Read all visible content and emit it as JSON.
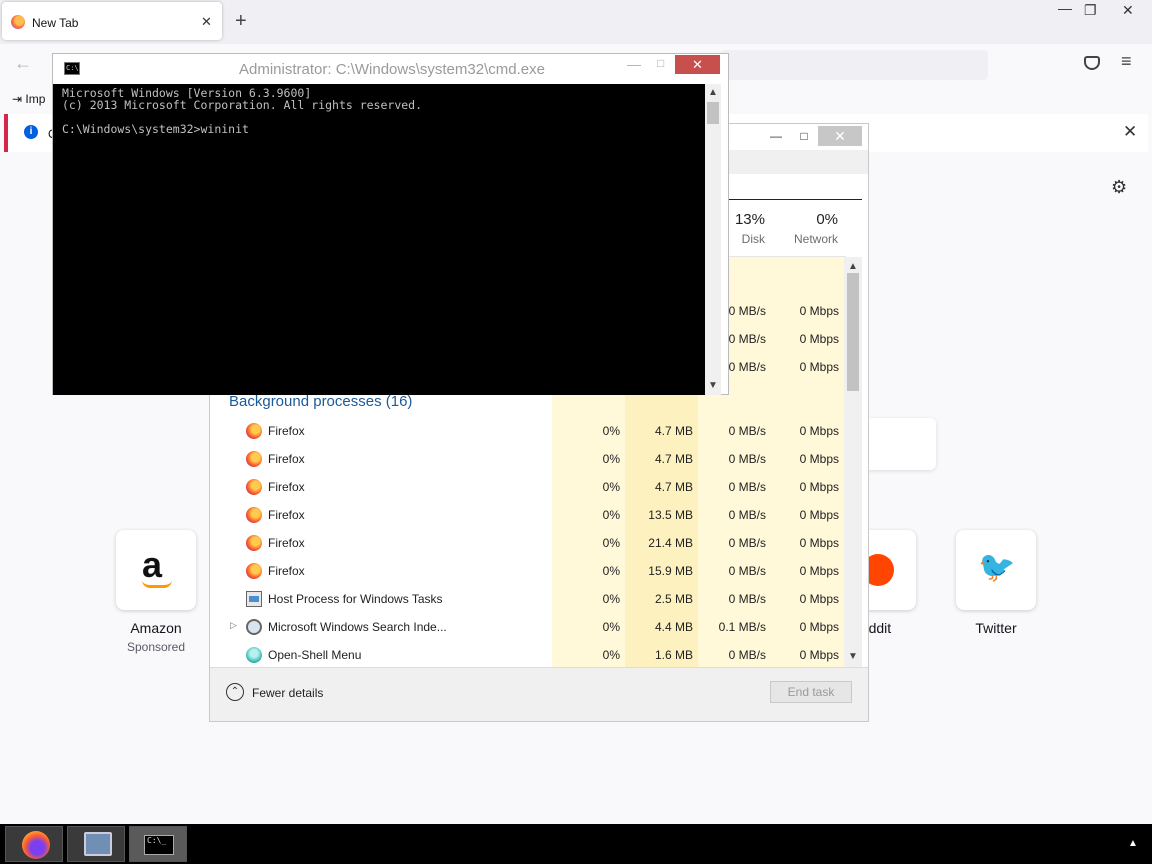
{
  "browser": {
    "tab_title": "New Tab",
    "tab_close": "✕",
    "new_tab": "+",
    "window_min": "—",
    "window_restore": "❐",
    "window_close": "✕",
    "back": "←",
    "menu": "≡",
    "bookmark_import": "Imp",
    "notice_text": "O",
    "notice_close": "✕",
    "settings": "⚙",
    "tiles": [
      {
        "label": "Amazon",
        "sub": "Sponsored",
        "glyph": "a"
      },
      {
        "label": "eddit",
        "sub": "",
        "glyph": "●"
      },
      {
        "label": "Twitter",
        "sub": "",
        "glyph": "🐦"
      }
    ]
  },
  "cmd": {
    "title": "Administrator: C:\\Windows\\system32\\cmd.exe",
    "icon_text": "C:\\",
    "min": "—",
    "max": "□",
    "close": "✕",
    "lines": [
      "Microsoft Windows [Version 6.3.9600]",
      "(c) 2013 Microsoft Corporation. All rights reserved.",
      "",
      "C:\\Windows\\system32>wininit"
    ]
  },
  "taskmgr": {
    "min": "—",
    "max": "□",
    "close": "✕",
    "columns": [
      {
        "pct": "13%",
        "label": "Disk"
      },
      {
        "pct": "0%",
        "label": "Network"
      }
    ],
    "partial_rows": [
      {
        "disk": "0 MB/s",
        "net": "0 Mbps"
      },
      {
        "disk": "0 MB/s",
        "net": "0 Mbps"
      },
      {
        "disk": "0 MB/s",
        "net": "0 Mbps"
      }
    ],
    "group_heading": "Background processes (16)",
    "processes": [
      {
        "name": "Firefox",
        "icon": "firefox-icon",
        "cpu": "0%",
        "mem": "4.7 MB",
        "disk": "0 MB/s",
        "net": "0 Mbps",
        "expand": ""
      },
      {
        "name": "Firefox",
        "icon": "firefox-icon",
        "cpu": "0%",
        "mem": "4.7 MB",
        "disk": "0 MB/s",
        "net": "0 Mbps",
        "expand": ""
      },
      {
        "name": "Firefox",
        "icon": "firefox-icon",
        "cpu": "0%",
        "mem": "4.7 MB",
        "disk": "0 MB/s",
        "net": "0 Mbps",
        "expand": ""
      },
      {
        "name": "Firefox",
        "icon": "firefox-icon",
        "cpu": "0%",
        "mem": "13.5 MB",
        "disk": "0 MB/s",
        "net": "0 Mbps",
        "expand": ""
      },
      {
        "name": "Firefox",
        "icon": "firefox-icon",
        "cpu": "0%",
        "mem": "21.4 MB",
        "disk": "0 MB/s",
        "net": "0 Mbps",
        "expand": ""
      },
      {
        "name": "Firefox",
        "icon": "firefox-icon",
        "cpu": "0%",
        "mem": "15.9 MB",
        "disk": "0 MB/s",
        "net": "0 Mbps",
        "expand": ""
      },
      {
        "name": "Host Process for Windows Tasks",
        "icon": "host-process-icon",
        "cpu": "0%",
        "mem": "2.5 MB",
        "disk": "0 MB/s",
        "net": "0 Mbps",
        "expand": ""
      },
      {
        "name": "Microsoft Windows Search Inde...",
        "icon": "search-indexer-icon",
        "cpu": "0%",
        "mem": "4.4 MB",
        "disk": "0.1 MB/s",
        "net": "0 Mbps",
        "expand": "▷"
      },
      {
        "name": "Open-Shell Menu",
        "icon": "open-shell-icon",
        "cpu": "0%",
        "mem": "1.6 MB",
        "disk": "0 MB/s",
        "net": "0 Mbps",
        "expand": ""
      }
    ],
    "fewer_details": "Fewer details",
    "fewer_icon": "⌃",
    "end_task": "End task",
    "scroll_up": "▲",
    "scroll_down": "▼"
  },
  "taskbar": {
    "cmd_icon_text": "C:\\_",
    "tray_arrow": "▲"
  }
}
